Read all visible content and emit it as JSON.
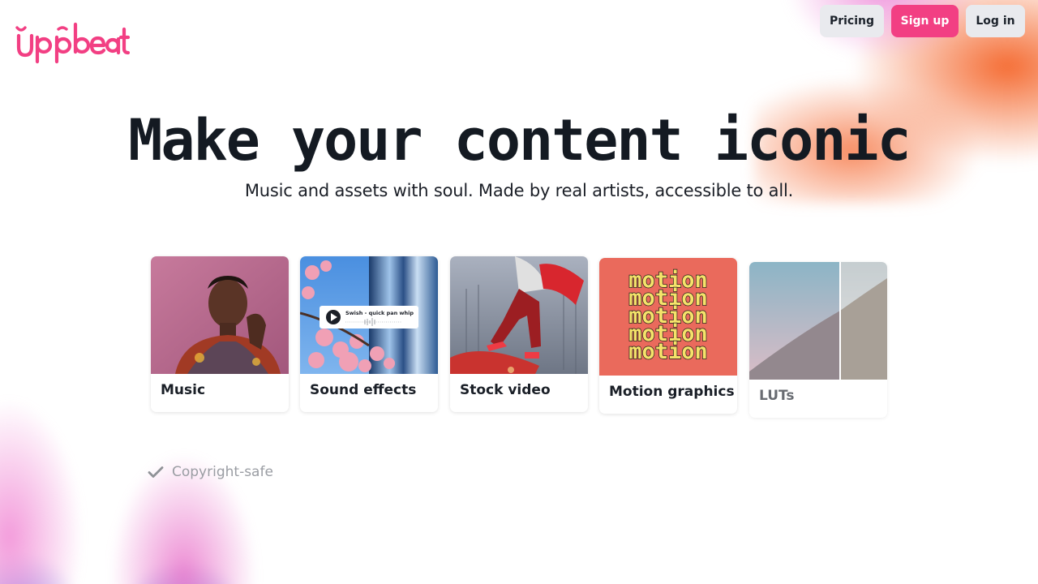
{
  "brand": {
    "logo_text": "uppbeat",
    "accent": "#f23f83"
  },
  "nav": {
    "pricing_label": "Pricing",
    "signup_label": "Sign up",
    "login_label": "Log in"
  },
  "hero": {
    "title": "Make your content iconic",
    "subtitle": "Music and assets with soul. Made by real artists, accessible to all."
  },
  "categories": [
    {
      "label": "Music",
      "icon": "portrait-photo"
    },
    {
      "label": "Sound effects",
      "icon": "blossom-photo",
      "overlay_text": "Swish - quick pan whip"
    },
    {
      "label": "Stock video",
      "icon": "skateboard-photo"
    },
    {
      "label": "Motion graphics",
      "icon": "motion-typography",
      "image_word": "motion"
    },
    {
      "label": "LUTs",
      "icon": "mountain-photo"
    }
  ],
  "features": [
    {
      "label": "Copyright-safe",
      "icon": "check-icon"
    }
  ]
}
